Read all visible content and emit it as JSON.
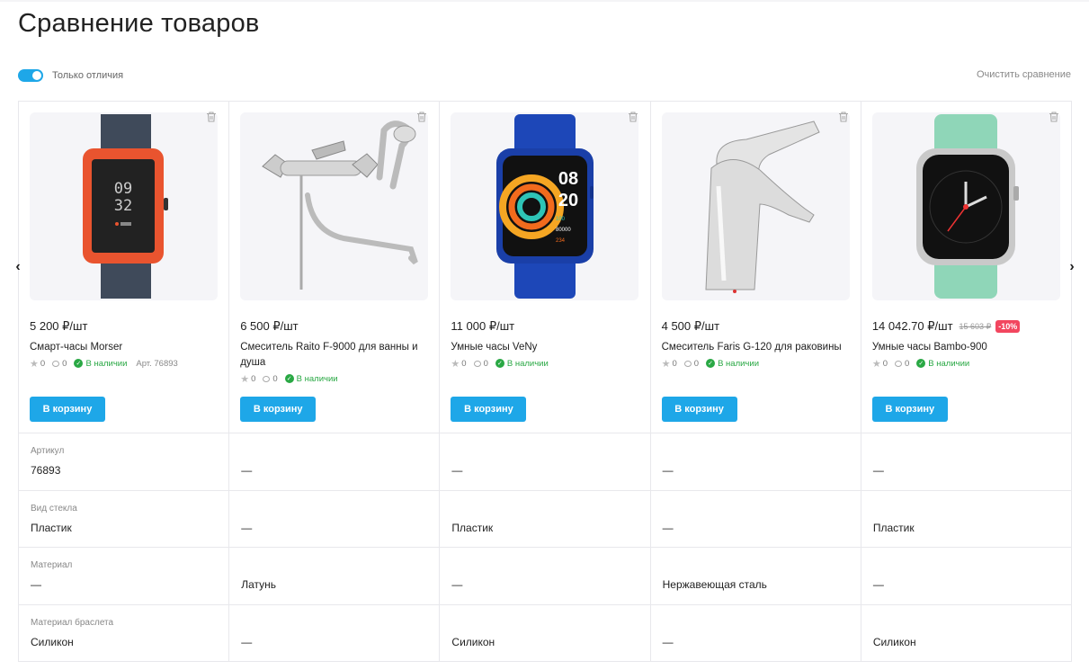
{
  "page": {
    "title": "Сравнение товаров"
  },
  "controls": {
    "only_diff_label": "Только отличия",
    "only_diff_on": true,
    "clear_label": "Очистить сравнение"
  },
  "nav": {
    "prev_glyph": "‹",
    "next_glyph": "›"
  },
  "cart_label": "В корзину",
  "products": [
    {
      "price": "5 200 ₽/шт",
      "old_price": "",
      "discount": "",
      "name": "Смарт-часы Morser",
      "rating": "0",
      "reviews": "0",
      "stock": "В наличии",
      "sku": "Арт. 76893",
      "image": "watch-orange-icon"
    },
    {
      "price": "6 500 ₽/шт",
      "old_price": "",
      "discount": "",
      "name": "Смеситель Raito F-9000 для ванны и душа",
      "rating": "0",
      "reviews": "0",
      "stock": "В наличии",
      "sku": "",
      "image": "bath-mixer-icon"
    },
    {
      "price": "11 000 ₽/шт",
      "old_price": "",
      "discount": "",
      "name": "Умные часы VeNy",
      "rating": "0",
      "reviews": "0",
      "stock": "В наличии",
      "sku": "",
      "image": "watch-blue-icon"
    },
    {
      "price": "4 500 ₽/шт",
      "old_price": "",
      "discount": "",
      "name": "Смеситель Faris G-120 для раковины",
      "rating": "0",
      "reviews": "0",
      "stock": "В наличии",
      "sku": "",
      "image": "basin-faucet-icon"
    },
    {
      "price": "14 042.70 ₽/шт",
      "old_price": "15 603 ₽",
      "discount": "-10%",
      "name": "Умные часы Bambo-900",
      "rating": "0",
      "reviews": "0",
      "stock": "В наличии",
      "sku": "",
      "image": "watch-mint-icon"
    }
  ],
  "watch_faces": {
    "orange": {
      "time_hh": "09",
      "time_mm": "32"
    },
    "blue": {
      "time_hh": "08",
      "time_mm": "20",
      "stat1": "100",
      "stat2": "80000",
      "stat3": "234"
    }
  },
  "attributes": [
    {
      "label": "Артикул",
      "values": [
        "76893",
        "—",
        "—",
        "—",
        "—"
      ]
    },
    {
      "label": "Вид стекла",
      "values": [
        "Пластик",
        "—",
        "Пластик",
        "—",
        "Пластик"
      ]
    },
    {
      "label": "Материал",
      "values": [
        "—",
        "Латунь",
        "—",
        "Нержавеющая сталь",
        "—"
      ]
    },
    {
      "label": "Материал браслета",
      "values": [
        "Силикон",
        "—",
        "Силикон",
        "—",
        "Силикон"
      ]
    }
  ],
  "colors": {
    "accent": "#1ea7e8",
    "stock": "#29a844",
    "discount": "#f2465f"
  }
}
